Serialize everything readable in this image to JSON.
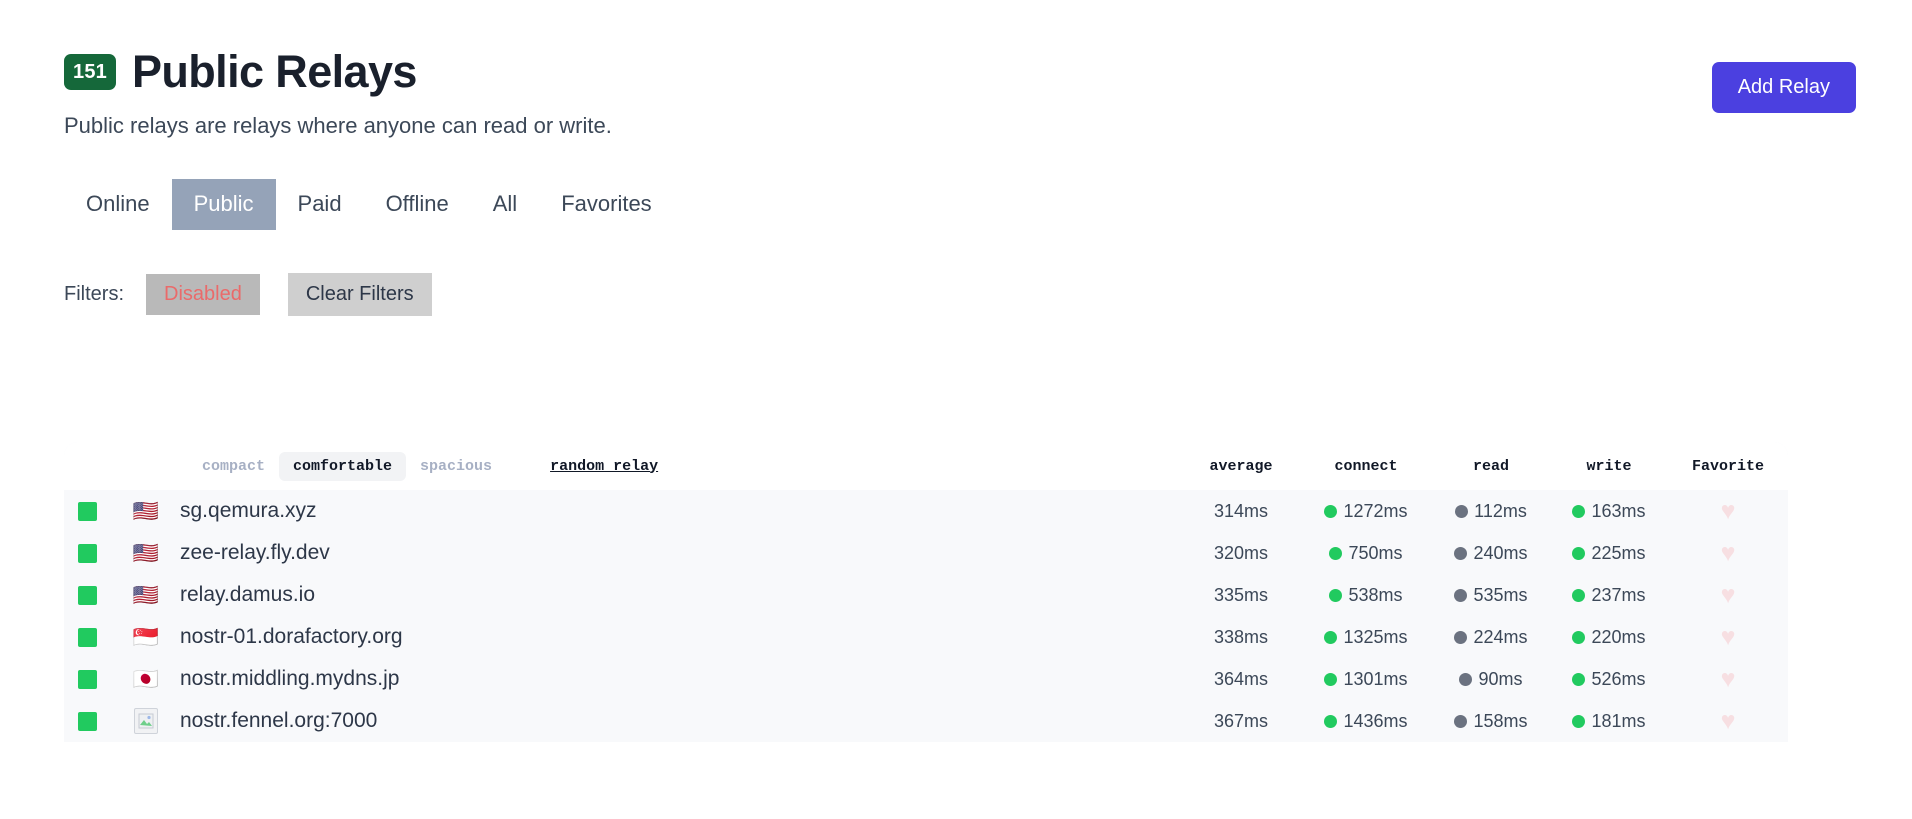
{
  "header": {
    "badge_count": "151",
    "title": "Public Relays",
    "subtitle": "Public relays are relays where anyone can read or write.",
    "add_relay_label": "Add Relay",
    "badge_color": "#15683a",
    "accent_color": "#4b40e0"
  },
  "tabs": [
    {
      "label": "Online",
      "active": false
    },
    {
      "label": "Public",
      "active": true
    },
    {
      "label": "Paid",
      "active": false
    },
    {
      "label": "Offline",
      "active": false
    },
    {
      "label": "All",
      "active": false
    },
    {
      "label": "Favorites",
      "active": false
    }
  ],
  "filters": {
    "label": "Filters:",
    "state_label": "Disabled",
    "state_color": "#ea6a6a",
    "clear_label": "Clear Filters"
  },
  "table": {
    "density_options": [
      {
        "label": "compact",
        "active": false
      },
      {
        "label": "comfortable",
        "active": true
      },
      {
        "label": "spacious",
        "active": false
      }
    ],
    "random_relay_label": "random relay",
    "columns": [
      {
        "key": "average",
        "label": "average"
      },
      {
        "key": "connect",
        "label": "connect"
      },
      {
        "key": "read",
        "label": "read"
      },
      {
        "key": "write",
        "label": "write"
      },
      {
        "key": "favorite",
        "label": "Favorite"
      }
    ],
    "rows": [
      {
        "status": "online",
        "status_icon": "green-square",
        "flag": "🇺🇸",
        "flag_name": "flag-us",
        "name": "sg.qemura.xyz",
        "average": "314ms",
        "connect": "1272ms",
        "connect_dot": "green",
        "read": "112ms",
        "read_dot": "gray",
        "write": "163ms",
        "write_dot": "green",
        "favorite_icon": "heart-outline-icon",
        "favorited": false
      },
      {
        "status": "online",
        "status_icon": "green-square",
        "flag": "🇺🇸",
        "flag_name": "flag-us",
        "name": "zee-relay.fly.dev",
        "average": "320ms",
        "connect": "750ms",
        "connect_dot": "green",
        "read": "240ms",
        "read_dot": "gray",
        "write": "225ms",
        "write_dot": "green",
        "favorite_icon": "heart-outline-icon",
        "favorited": false
      },
      {
        "status": "online",
        "status_icon": "green-square",
        "flag": "🇺🇸",
        "flag_name": "flag-us",
        "name": "relay.damus.io",
        "average": "335ms",
        "connect": "538ms",
        "connect_dot": "green",
        "read": "535ms",
        "read_dot": "gray",
        "write": "237ms",
        "write_dot": "green",
        "favorite_icon": "heart-outline-icon",
        "favorited": false
      },
      {
        "status": "online",
        "status_icon": "green-square",
        "flag": "🇸🇬",
        "flag_name": "flag-sg",
        "name": "nostr-01.dorafactory.org",
        "average": "338ms",
        "connect": "1325ms",
        "connect_dot": "green",
        "read": "224ms",
        "read_dot": "gray",
        "write": "220ms",
        "write_dot": "green",
        "favorite_icon": "heart-outline-icon",
        "favorited": false
      },
      {
        "status": "online",
        "status_icon": "green-square",
        "flag": "🇯🇵",
        "flag_name": "flag-jp",
        "name": "nostr.middling.mydns.jp",
        "average": "364ms",
        "connect": "1301ms",
        "connect_dot": "green",
        "read": "90ms",
        "read_dot": "gray",
        "write": "526ms",
        "write_dot": "green",
        "favorite_icon": "heart-outline-icon",
        "favorited": false
      },
      {
        "status": "online",
        "status_icon": "green-square",
        "flag": "",
        "flag_name": "flag-missing",
        "name": "nostr.fennel.org:7000",
        "average": "367ms",
        "connect": "1436ms",
        "connect_dot": "green",
        "read": "158ms",
        "read_dot": "gray",
        "write": "181ms",
        "write_dot": "green",
        "favorite_icon": "heart-outline-icon",
        "favorited": false
      }
    ],
    "heart_glyph": "♥"
  }
}
